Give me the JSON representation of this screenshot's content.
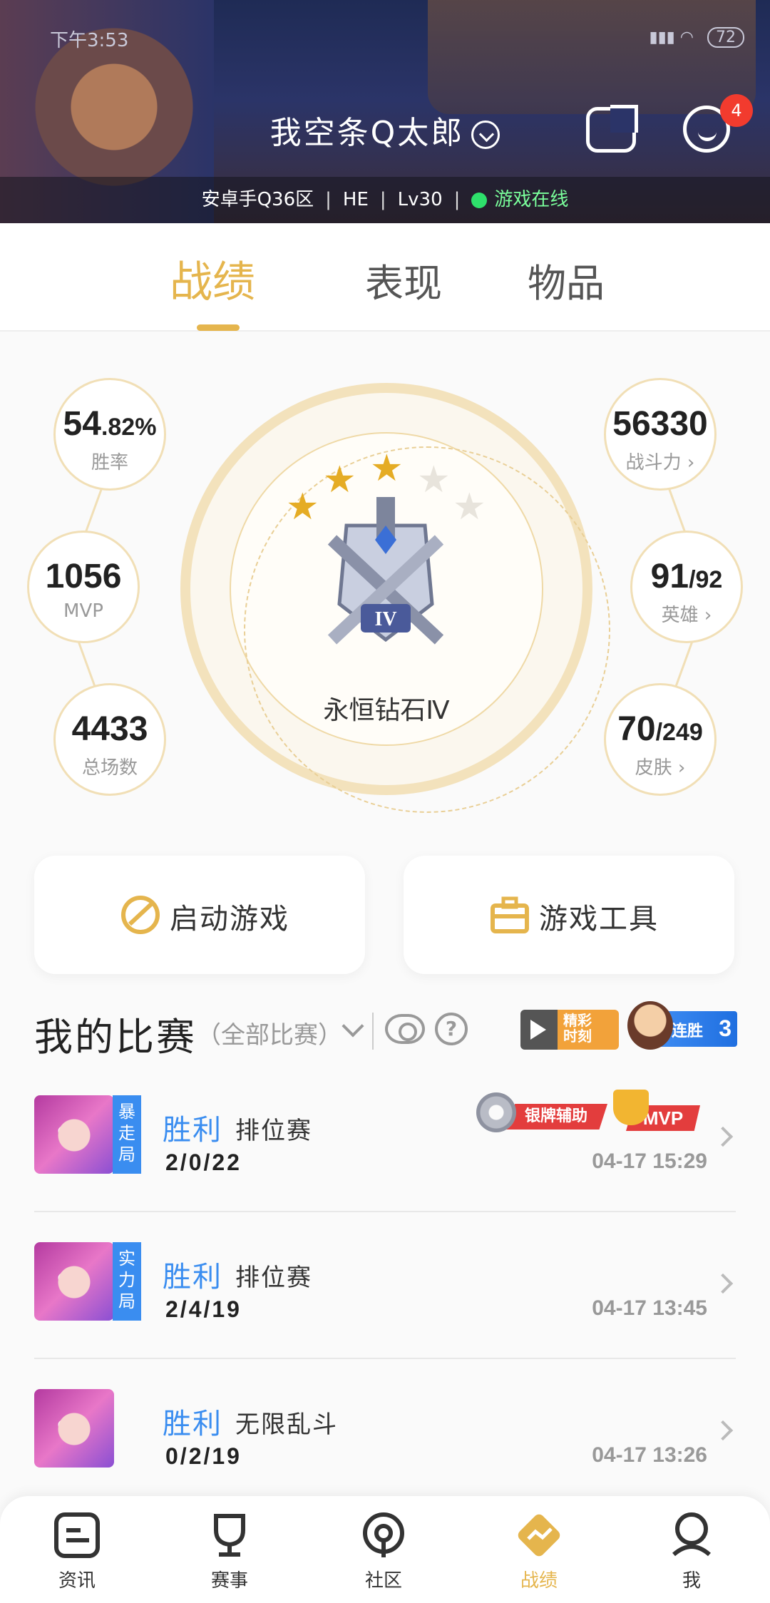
{
  "status_bar": {
    "time": "下午3:53",
    "battery": "72"
  },
  "header": {
    "nickname": "我空条Q太郎",
    "message_badge": "4",
    "server": "安卓手Q36区",
    "guild": "HE",
    "level": "Lv30",
    "online_status": "游戏在线"
  },
  "tabs": [
    "战绩",
    "表现",
    "物品"
  ],
  "stats": {
    "win_rate_main": "54",
    "win_rate_small": ".82%",
    "win_rate_label": "胜率",
    "mvp_value": "1056",
    "mvp_label": "MVP",
    "total_value": "4433",
    "total_label": "总场数",
    "power_value": "56330",
    "power_label": "战斗力",
    "heroes_main": "91",
    "heroes_small": "/92",
    "heroes_label": "英雄",
    "skins_main": "70",
    "skins_small": "/249",
    "skins_label": "皮肤"
  },
  "rank": {
    "name": "永恒钻石Ⅳ",
    "stars_filled": 3,
    "stars_total": 5,
    "tier": "IV"
  },
  "actions": {
    "launch": "启动游戏",
    "tools": "游戏工具"
  },
  "matches_header": {
    "title": "我的比赛",
    "filter": "（全部比赛）",
    "highlight_line1": "精彩",
    "highlight_line2": "时刻",
    "streak_label": "连胜",
    "streak_count": "3"
  },
  "matches": [
    {
      "mode_tag": "暴走局",
      "result": "胜利",
      "type": "排位赛",
      "kda": "2/0/22",
      "time": "04-17 15:29",
      "badge_silver": "银牌辅助",
      "badge_mvp": "MVP"
    },
    {
      "mode_tag": "实力局",
      "result": "胜利",
      "type": "排位赛",
      "kda": "2/4/19",
      "time": "04-17 13:45"
    },
    {
      "mode_tag": "",
      "result": "胜利",
      "type": "无限乱斗",
      "kda": "0/2/19",
      "time": "04-17 13:26"
    }
  ],
  "nav": [
    "资讯",
    "赛事",
    "社区",
    "战绩",
    "我"
  ],
  "colors": {
    "accent": "#e5b54d",
    "win": "#3a8df0",
    "badge_red": "#e33d3d"
  }
}
